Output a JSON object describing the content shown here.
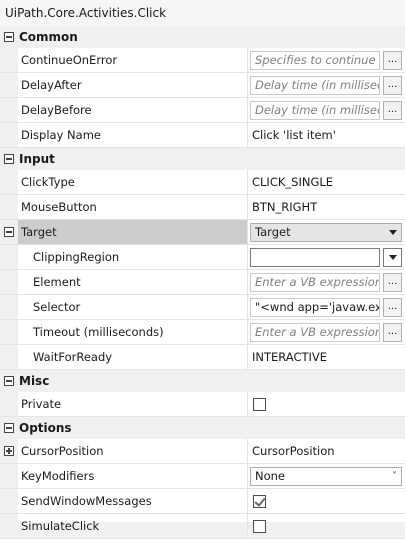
{
  "title": "UiPath.Core.Activities.Click",
  "categories": {
    "common": "Common",
    "input": "Input",
    "misc": "Misc",
    "options": "Options"
  },
  "common": {
    "continue_on_error": {
      "name": "ContinueOnError",
      "placeholder": "Specifies to continue exe"
    },
    "delay_after": {
      "name": "DelayAfter",
      "placeholder": "Delay time (in milliseco"
    },
    "delay_before": {
      "name": "DelayBefore",
      "placeholder": "Delay time (in millisecon"
    },
    "display_name": {
      "name": "Display Name",
      "value": "Click 'list item'"
    }
  },
  "input": {
    "click_type": {
      "name": "ClickType",
      "value": "CLICK_SINGLE"
    },
    "mouse_button": {
      "name": "MouseButton",
      "value": "BTN_RIGHT"
    },
    "target": {
      "name": "Target",
      "value": "Target"
    },
    "clipping_region": {
      "name": "ClippingRegion",
      "value": ""
    },
    "element": {
      "name": "Element",
      "placeholder": "Enter a VB expression"
    },
    "selector": {
      "name": "Selector",
      "value": "\"<wnd app='javaw.exe'"
    },
    "timeout": {
      "name": "Timeout (milliseconds)",
      "placeholder": "Enter a VB expression"
    },
    "wait_for_ready": {
      "name": "WaitForReady",
      "value": "INTERACTIVE"
    }
  },
  "misc": {
    "private": {
      "name": "Private",
      "checked": false
    }
  },
  "options": {
    "cursor_position": {
      "name": "CursorPosition",
      "value": "CursorPosition"
    },
    "key_modifiers": {
      "name": "KeyModifiers",
      "value": "None"
    },
    "send_window_messages": {
      "name": "SendWindowMessages",
      "checked": true
    },
    "simulate_click": {
      "name": "SimulateClick",
      "checked": false
    }
  },
  "glyphs": {
    "ellipsis": "...",
    "chevron": "˅"
  }
}
